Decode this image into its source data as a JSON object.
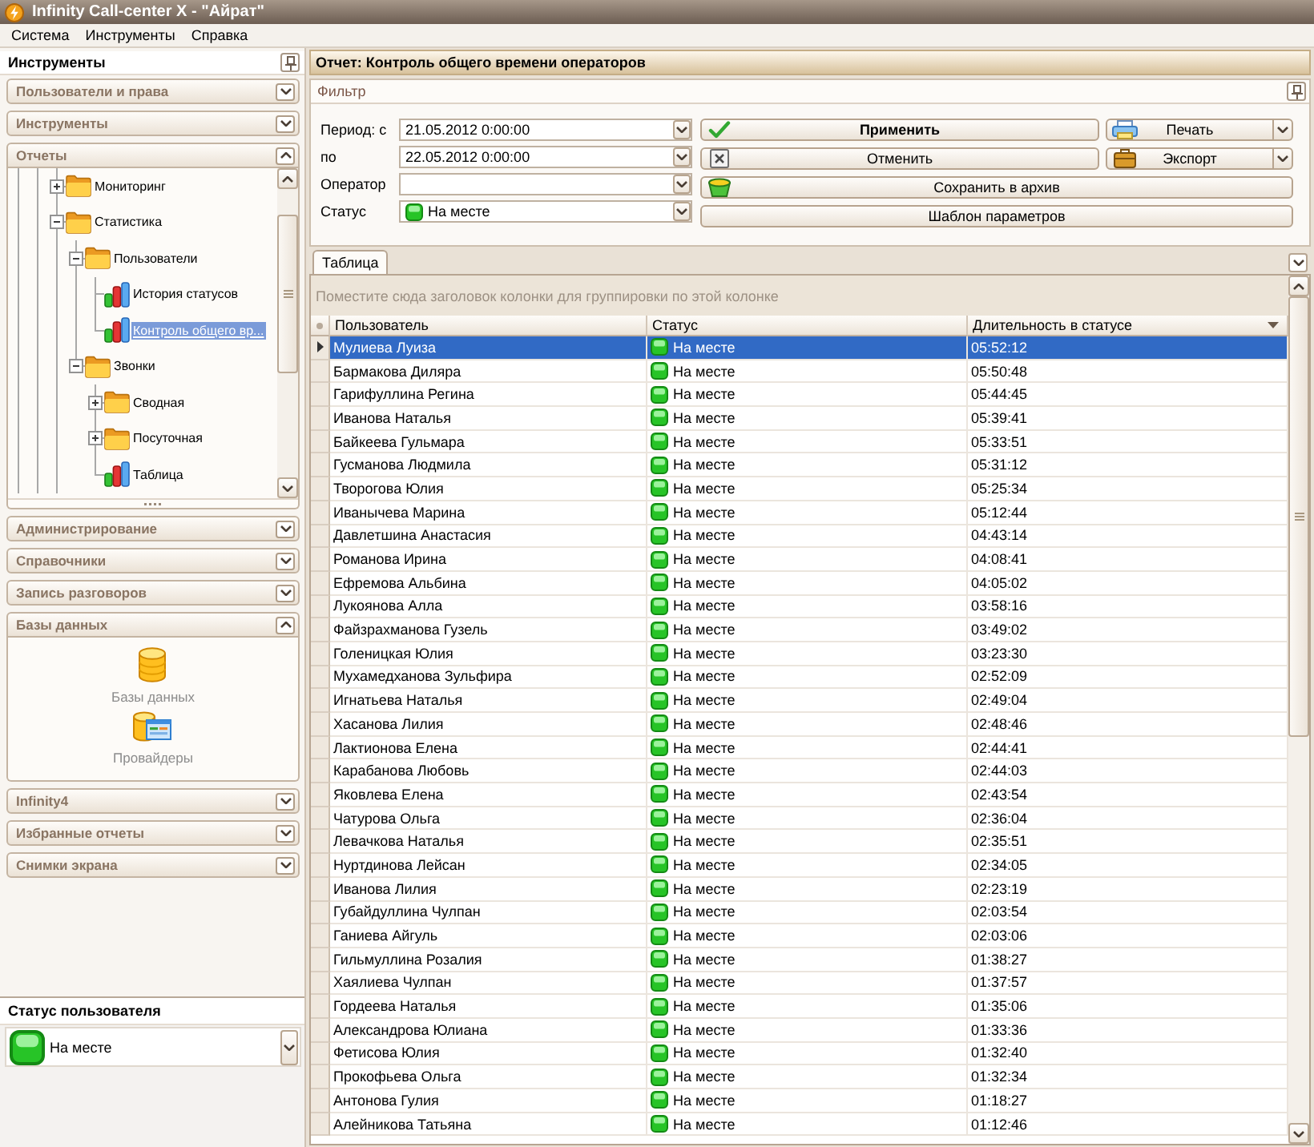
{
  "window": {
    "title": "Infinity Call-center X - \"Айрат\""
  },
  "menu": [
    "Система",
    "Инструменты",
    "Справка"
  ],
  "tools_panel": {
    "title": "Инструменты",
    "sections": [
      {
        "title": "Пользователи и права",
        "expanded": false
      },
      {
        "title": "Инструменты",
        "expanded": false
      },
      {
        "title": "Отчеты",
        "expanded": true,
        "tree": [
          {
            "label": "Мониторинг",
            "kind": "folder",
            "expanded": false,
            "selected": false
          },
          {
            "label": "Статистика",
            "kind": "folder",
            "expanded": true,
            "selected": false,
            "children": [
              {
                "label": "Пользователи",
                "kind": "folder",
                "expanded": true,
                "selected": false,
                "children": [
                  {
                    "label": "История статусов",
                    "kind": "report",
                    "selected": false
                  },
                  {
                    "label": "Контроль общего вр...",
                    "kind": "report",
                    "selected": true
                  }
                ]
              },
              {
                "label": "Звонки",
                "kind": "folder",
                "expanded": true,
                "selected": false,
                "children": [
                  {
                    "label": "Сводная",
                    "kind": "folder",
                    "expanded": false,
                    "selected": false
                  },
                  {
                    "label": "Посуточная",
                    "kind": "folder",
                    "expanded": false,
                    "selected": false
                  },
                  {
                    "label": "Таблица",
                    "kind": "report",
                    "selected": false
                  }
                ]
              }
            ]
          }
        ]
      },
      {
        "title": "Администрирование",
        "expanded": false
      },
      {
        "title": "Справочники",
        "expanded": false
      },
      {
        "title": "Запись разговоров",
        "expanded": false
      },
      {
        "title": "Базы данных",
        "expanded": true,
        "items": [
          {
            "label": "Базы данных",
            "kind": "database"
          },
          {
            "label": "Провайдеры",
            "kind": "provider"
          }
        ]
      },
      {
        "title": "Infinity4",
        "expanded": false
      },
      {
        "title": "Избранные отчеты",
        "expanded": false
      },
      {
        "title": "Снимки экрана",
        "expanded": false
      }
    ]
  },
  "user_status": {
    "title": "Статус пользователя",
    "value": "На месте"
  },
  "report": {
    "title": "Отчет: Контроль общего времени операторов",
    "filter": {
      "title": "Фильтр",
      "fields": [
        {
          "label": "Период: с",
          "kind": "text",
          "value": "21.05.2012 0:00:00"
        },
        {
          "label": "по",
          "kind": "text",
          "value": "22.05.2012 0:00:00"
        },
        {
          "label": "Оператор",
          "kind": "text"
        },
        {
          "label": "Статус",
          "kind": "status",
          "value": "На месте"
        }
      ],
      "buttons": [
        {
          "label": "Применить",
          "kind": "apply",
          "default": true,
          "dropdown": false
        },
        {
          "label": "Печать",
          "kind": "print",
          "default": false,
          "dropdown": true
        },
        {
          "label": "Отменить",
          "kind": "cancel",
          "default": false,
          "dropdown": false
        },
        {
          "label": "Экспорт",
          "kind": "export",
          "default": false,
          "dropdown": true
        },
        {
          "label": "Сохранить в архив",
          "kind": "archive",
          "default": false,
          "dropdown": false
        },
        {
          "label": "Шаблон параметров",
          "kind": "template",
          "default": false,
          "dropdown": false
        }
      ]
    },
    "tabs": [
      {
        "label": "Таблица",
        "selected": true
      }
    ],
    "table": {
      "group_hint": "Поместите сюда заголовок колонки для группировки по этой колонке",
      "columns": [
        {
          "label": "Пользователь",
          "sorted_descending": false
        },
        {
          "label": "Статус",
          "sorted_descending": false
        },
        {
          "label": "Длительность в статусе",
          "sorted_descending": true
        }
      ],
      "rows": [
        {
          "user": "Мулиева Луиза",
          "status": "На месте",
          "duration": "05:52:12",
          "selected": true
        },
        {
          "user": "Бармакова Диляра",
          "status": "На месте",
          "duration": "05:50:48",
          "selected": false
        },
        {
          "user": "Гарифуллина Регина",
          "status": "На месте",
          "duration": "05:44:45",
          "selected": false
        },
        {
          "user": "Иванова Наталья",
          "status": "На месте",
          "duration": "05:39:41",
          "selected": false
        },
        {
          "user": "Байкеева Гульмара",
          "status": "На месте",
          "duration": "05:33:51",
          "selected": false
        },
        {
          "user": "Гусманова Людмила",
          "status": "На месте",
          "duration": "05:31:12",
          "selected": false
        },
        {
          "user": "Творогова Юлия",
          "status": "На месте",
          "duration": "05:25:34",
          "selected": false
        },
        {
          "user": "Иванычева Марина",
          "status": "На месте",
          "duration": "05:12:44",
          "selected": false
        },
        {
          "user": "Давлетшина Анастасия",
          "status": "На месте",
          "duration": "04:43:14",
          "selected": false
        },
        {
          "user": "Романова Ирина",
          "status": "На месте",
          "duration": "04:08:41",
          "selected": false
        },
        {
          "user": "Ефремова Альбина",
          "status": "На месте",
          "duration": "04:05:02",
          "selected": false
        },
        {
          "user": "Лукоянова Алла",
          "status": "На месте",
          "duration": "03:58:16",
          "selected": false
        },
        {
          "user": "Файзрахманова Гузель",
          "status": "На месте",
          "duration": "03:49:02",
          "selected": false
        },
        {
          "user": "Голеницкая Юлия",
          "status": "На месте",
          "duration": "03:23:30",
          "selected": false
        },
        {
          "user": "Мухамедханова Зульфира",
          "status": "На месте",
          "duration": "02:52:09",
          "selected": false
        },
        {
          "user": "Игнатьева Наталья",
          "status": "На месте",
          "duration": "02:49:04",
          "selected": false
        },
        {
          "user": "Хасанова Лилия",
          "status": "На месте",
          "duration": "02:48:46",
          "selected": false
        },
        {
          "user": "Лактионова Елена",
          "status": "На месте",
          "duration": "02:44:41",
          "selected": false
        },
        {
          "user": "Карабанова Любовь",
          "status": "На месте",
          "duration": "02:44:03",
          "selected": false
        },
        {
          "user": "Яковлева Елена",
          "status": "На месте",
          "duration": "02:43:54",
          "selected": false
        },
        {
          "user": "Чатурова Ольга",
          "status": "На месте",
          "duration": "02:36:04",
          "selected": false
        },
        {
          "user": "Левачкова Наталья",
          "status": "На месте",
          "duration": "02:35:51",
          "selected": false
        },
        {
          "user": "Нуртдинова Лейсан",
          "status": "На месте",
          "duration": "02:34:05",
          "selected": false
        },
        {
          "user": "Иванова Лилия",
          "status": "На месте",
          "duration": "02:23:19",
          "selected": false
        },
        {
          "user": "Губайдуллина Чулпан",
          "status": "На месте",
          "duration": "02:03:54",
          "selected": false
        },
        {
          "user": "Ганиева Айгуль",
          "status": "На месте",
          "duration": "02:03:06",
          "selected": false
        },
        {
          "user": "Гильмуллина Розалия",
          "status": "На месте",
          "duration": "01:38:27",
          "selected": false
        },
        {
          "user": "Хаялиева Чулпан",
          "status": "На месте",
          "duration": "01:37:57",
          "selected": false
        },
        {
          "user": "Гордеева Наталья",
          "status": "На месте",
          "duration": "01:35:06",
          "selected": false
        },
        {
          "user": "Александрова Юлиана",
          "status": "На месте",
          "duration": "01:33:36",
          "selected": false
        },
        {
          "user": "Фетисова Юлия",
          "status": "На месте",
          "duration": "01:32:40",
          "selected": false
        },
        {
          "user": "Прокофьева Ольга",
          "status": "На месте",
          "duration": "01:32:34",
          "selected": false
        },
        {
          "user": "Антонова Гулия",
          "status": "На месте",
          "duration": "01:18:27",
          "selected": false
        },
        {
          "user": "Алейникова Татьяна",
          "status": "На месте",
          "duration": "01:12:46",
          "selected": false
        }
      ]
    }
  }
}
